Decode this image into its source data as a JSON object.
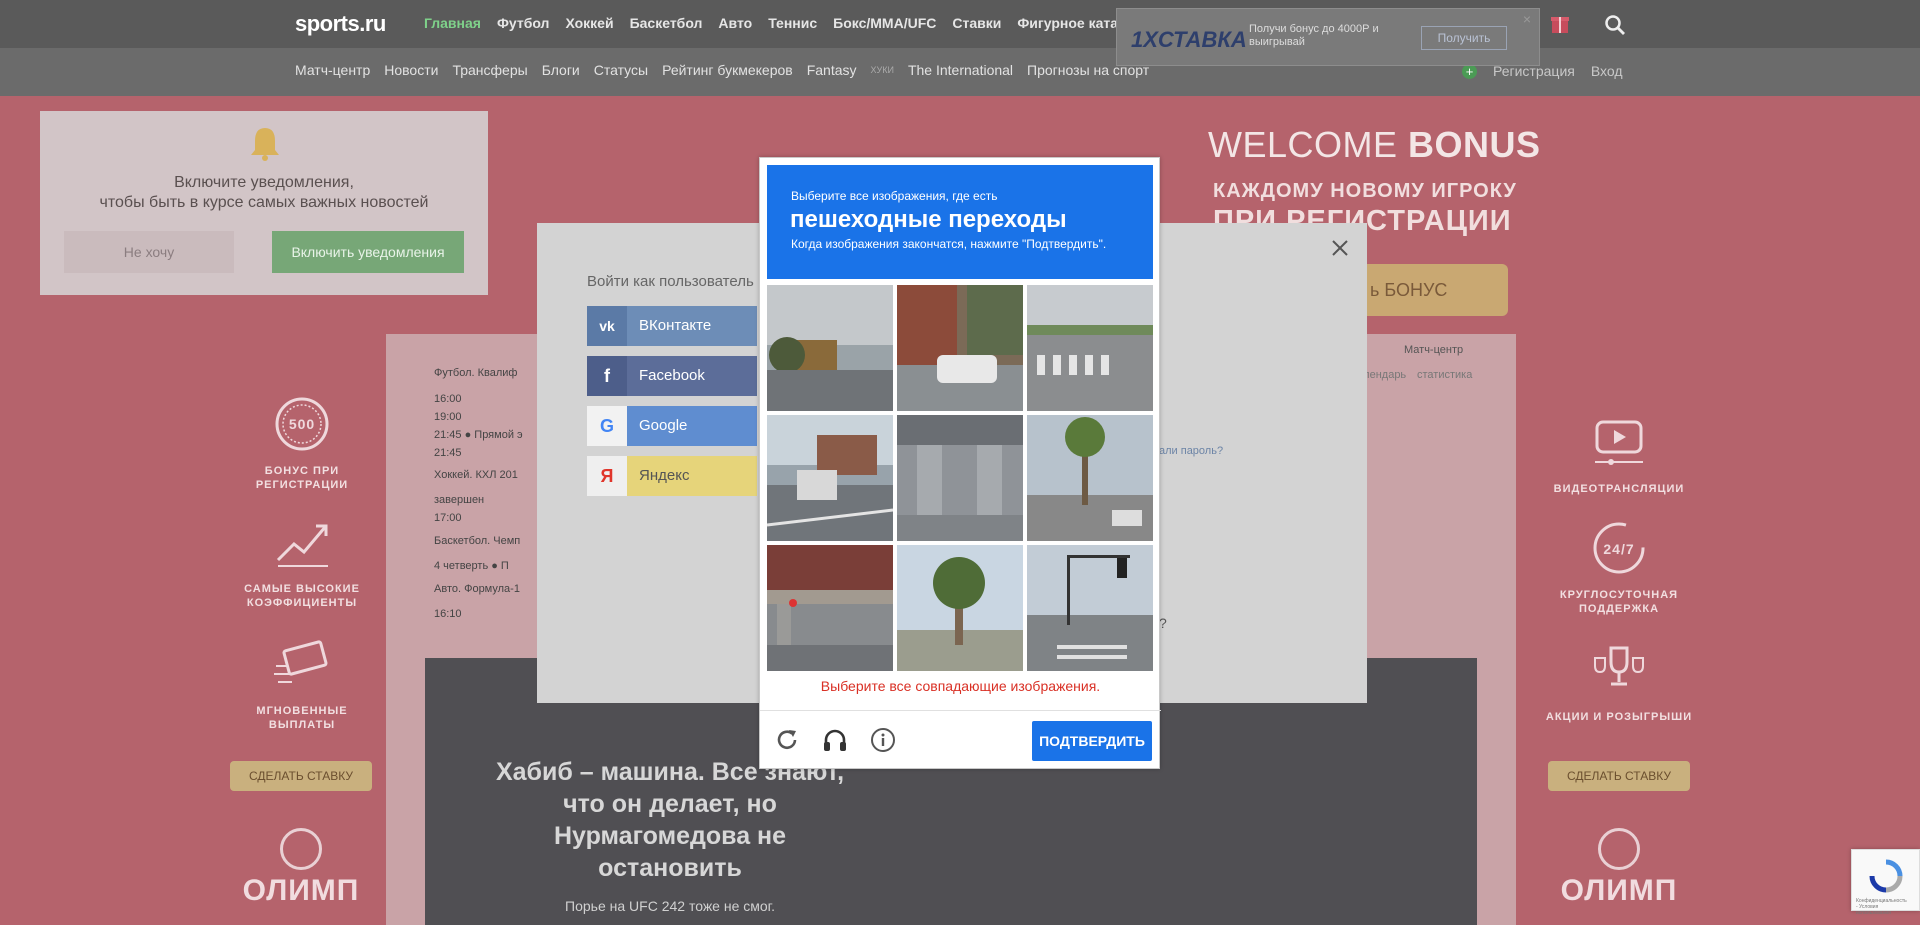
{
  "header": {
    "logo": "sports.ru",
    "nav": [
      "Главная",
      "Футбол",
      "Хоккей",
      "Баскетбол",
      "Авто",
      "Теннис",
      "Бокс/ММА/UFC",
      "Ставки",
      "Фигурное катание"
    ],
    "active_nav": "Главная"
  },
  "subheader": {
    "nav": [
      "Матч-центр",
      "Новости",
      "Трансферы",
      "Блоги",
      "Статусы",
      "Рейтинг букмекеров",
      "Fantasy"
    ],
    "tiny": "ХУКИ",
    "nav2": [
      "The International",
      "Прогнозы на спорт"
    ],
    "register": "Регистрация",
    "login": "Вход"
  },
  "ad": {
    "brand": "1XСТАВКА",
    "text": "Получи бонус до 4000Р и выигрывай",
    "button": "Получить",
    "close": "×"
  },
  "promo": {
    "welcome_thin": "WELCOME ",
    "welcome_bold": "BONUS",
    "line1": "КАЖДОМУ НОВОМУ ИГРОКУ",
    "line2": "ПРИ РЕГИСТРАЦИИ",
    "bonus_button": "ь БОНУС",
    "left_features": [
      "БОНУС ПРИ РЕГИСТРАЦИИ",
      "САМЫЕ ВЫСОКИЕ КОЭФФИЦИЕНТЫ",
      "МГНОВЕННЫЕ ВЫПЛАТЫ"
    ],
    "right_features": [
      "ВИДЕОТРАНСЛЯЦИИ",
      "КРУГЛОСУТОЧНАЯ ПОДДЕРЖКА",
      "АКЦИИ И РОЗЫГРЫШИ"
    ],
    "badge_500": "500",
    "badge_247": "24/7",
    "stake_button": "СДЕЛАТЬ СТАВКУ",
    "olimp": "ОЛИМП"
  },
  "matches": {
    "rows": [
      "Футбол. Квалиф",
      "16:00",
      "19:00",
      "21:45  ●  Прямой э",
      "21:45",
      "Хоккей. КХЛ 201",
      "завершен",
      "17:00",
      "Баскетбол. Чемп",
      "4 четверть  ●  П",
      "Авто. Формула-1",
      "16:10"
    ],
    "right_links": [
      "Матч-центр"
    ],
    "right_labels": [
      "календарь",
      "статистика"
    ]
  },
  "hero": {
    "title": "Хабиб – машина. Все знают, что он делает, но Нурмагомедова не остановить",
    "subtitle": "Порье на UFC 242 тоже не смог."
  },
  "notification": {
    "message": "Включите уведомления,\nчтобы быть в курсе самых важных новостей",
    "no_button": "Не хочу",
    "yes_button": "Включить уведомления"
  },
  "login": {
    "title": "Войти как пользователь",
    "providers": [
      {
        "label": "ВКонтакте",
        "color": "#6d8db7",
        "icon_color": "#4f6e99"
      },
      {
        "label": "Facebook",
        "color": "#5c6d99",
        "icon_color": "#4a5c87"
      },
      {
        "label": "Google",
        "color": "#5f8dd0",
        "icon_color": "#ffffff"
      },
      {
        "label": "Яндекс",
        "color": "#e8d36a",
        "icon_color": "#ffffff"
      }
    ],
    "forgot": "али пароль?",
    "question": "?"
  },
  "captcha": {
    "line1": "Выберите все изображения, где есть",
    "line2": "пешеходные переходы",
    "line3": "Когда изображения закончатся, нажмите \"Подтвердить\".",
    "error": "Выберите все совпадающие изображения.",
    "verify": "ПОДТВЕРДИТЬ"
  },
  "recaptcha_badge": "Конфиденциальность - Условия использования"
}
